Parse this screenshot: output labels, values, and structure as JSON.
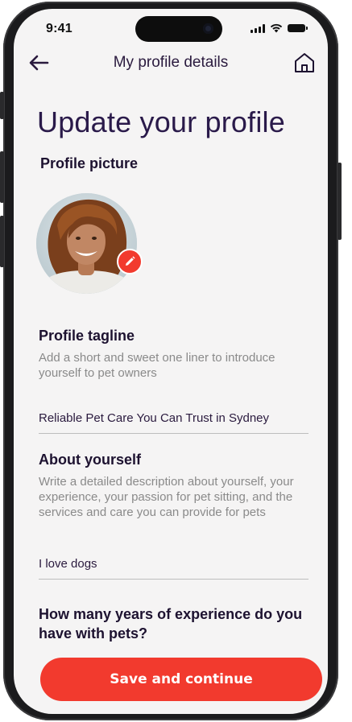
{
  "status_bar": {
    "time": "9:41"
  },
  "header": {
    "title": "My profile details",
    "back_icon": "arrow-left-icon",
    "home_icon": "home-icon"
  },
  "page_title": "Update your profile",
  "profile_picture": {
    "label": "Profile picture",
    "edit_icon": "pencil-icon"
  },
  "tagline": {
    "label": "Profile tagline",
    "hint": "Add a short and sweet one liner to introduce yourself to pet owners",
    "value": "Reliable Pet Care You Can Trust in Sydney"
  },
  "about": {
    "label": "About yourself",
    "hint": "Write a detailed description about yourself, your experience, your passion for pet sitting, and the services and care you can provide for pets",
    "value": "I love dogs"
  },
  "experience": {
    "label": "How many years of experience do you have with pets?"
  },
  "save_button": {
    "label": "Save and continue"
  },
  "colors": {
    "accent": "#f23a2e",
    "heading": "#2a1a4a",
    "background": "#f5f4f4"
  }
}
